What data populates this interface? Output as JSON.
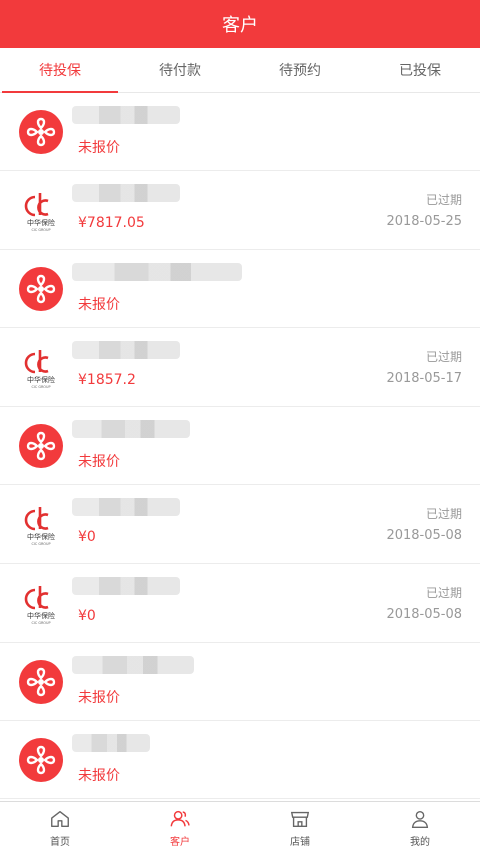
{
  "header": {
    "title": "客户"
  },
  "tabs": [
    {
      "label": "待投保",
      "active": true
    },
    {
      "label": "待付款",
      "active": false
    },
    {
      "label": "待预约",
      "active": false
    },
    {
      "label": "已投保",
      "active": false
    }
  ],
  "rows": [
    {
      "logo": "red-cross-logo",
      "sub": "未报价",
      "status": "",
      "date": ""
    },
    {
      "logo": "zhonghua-insurance-logo",
      "sub": "¥7817.05",
      "status": "已过期",
      "date": "2018-05-25"
    },
    {
      "logo": "red-cross-logo",
      "sub": "未报价",
      "status": "",
      "date": ""
    },
    {
      "logo": "zhonghua-insurance-logo",
      "sub": "¥1857.2",
      "status": "已过期",
      "date": "2018-05-17"
    },
    {
      "logo": "red-cross-logo",
      "sub": "未报价",
      "status": "",
      "date": ""
    },
    {
      "logo": "zhonghua-insurance-logo",
      "sub": "¥0",
      "status": "已过期",
      "date": "2018-05-08"
    },
    {
      "logo": "zhonghua-insurance-logo",
      "sub": "¥0",
      "status": "已过期",
      "date": "2018-05-08"
    },
    {
      "logo": "red-cross-logo",
      "sub": "未报价",
      "status": "",
      "date": ""
    },
    {
      "logo": "red-cross-logo",
      "sub": "未报价",
      "status": "",
      "date": ""
    }
  ],
  "logo_text": {
    "zhonghua_cn": "中华保险",
    "zhonghua_en": "CIC GROUP"
  },
  "tabbar": [
    {
      "label": "首页",
      "icon": "home-icon",
      "active": false
    },
    {
      "label": "客户",
      "icon": "customers-icon",
      "active": true
    },
    {
      "label": "店铺",
      "icon": "store-icon",
      "active": false
    },
    {
      "label": "我的",
      "icon": "user-icon",
      "active": false
    }
  ],
  "colors": {
    "accent": "#f23a3c",
    "muted": "#999999"
  }
}
